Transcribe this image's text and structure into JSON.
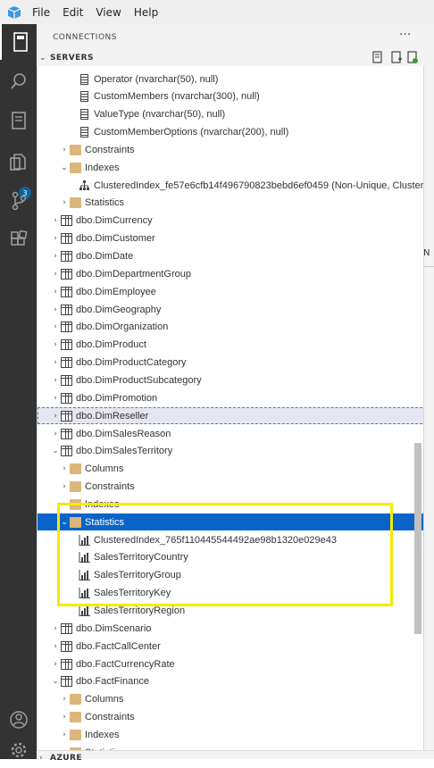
{
  "menu": {
    "items": [
      "File",
      "Edit",
      "View",
      "Help"
    ]
  },
  "sidebar": {
    "title": "CONNECTIONS",
    "more": "···"
  },
  "servers": {
    "label": "SERVERS"
  },
  "azure": {
    "label": "AZURE"
  },
  "activity": {
    "badge": "3"
  },
  "editor": {
    "tab_fragment": "N"
  },
  "tree": [
    {
      "indent": 4,
      "icon": "column-icon",
      "label": "Operator (nvarchar(50), null)"
    },
    {
      "indent": 4,
      "icon": "column-icon",
      "label": "CustomMembers (nvarchar(300), null)"
    },
    {
      "indent": 4,
      "icon": "column-icon",
      "label": "ValueType (nvarchar(50), null)"
    },
    {
      "indent": 4,
      "icon": "column-icon",
      "label": "CustomMemberOptions (nvarchar(200), null)"
    },
    {
      "indent": 3,
      "twisty": "›",
      "icon": "folder-icon",
      "label": "Constraints"
    },
    {
      "indent": 3,
      "twisty": "⌄",
      "icon": "folder-icon",
      "label": "Indexes"
    },
    {
      "indent": 4,
      "icon": "index-icon",
      "label": "ClusteredIndex_fe57e6cfb14f496790823bebd6ef0459 (Non-Unique, Cluster..."
    },
    {
      "indent": 3,
      "twisty": "›",
      "icon": "folder-icon",
      "label": "Statistics"
    },
    {
      "indent": 2,
      "twisty": "›",
      "icon": "table-icon",
      "label": "dbo.DimCurrency"
    },
    {
      "indent": 2,
      "twisty": "›",
      "icon": "table-icon",
      "label": "dbo.DimCustomer"
    },
    {
      "indent": 2,
      "twisty": "›",
      "icon": "table-icon",
      "label": "dbo.DimDate"
    },
    {
      "indent": 2,
      "twisty": "›",
      "icon": "table-icon",
      "label": "dbo.DimDepartmentGroup"
    },
    {
      "indent": 2,
      "twisty": "›",
      "icon": "table-icon",
      "label": "dbo.DimEmployee"
    },
    {
      "indent": 2,
      "twisty": "›",
      "icon": "table-icon",
      "label": "dbo.DimGeography"
    },
    {
      "indent": 2,
      "twisty": "›",
      "icon": "table-icon",
      "label": "dbo.DimOrganization"
    },
    {
      "indent": 2,
      "twisty": "›",
      "icon": "table-icon",
      "label": "dbo.DimProduct"
    },
    {
      "indent": 2,
      "twisty": "›",
      "icon": "table-icon",
      "label": "dbo.DimProductCategory"
    },
    {
      "indent": 2,
      "twisty": "›",
      "icon": "table-icon",
      "label": "dbo.DimProductSubcategory"
    },
    {
      "indent": 2,
      "twisty": "›",
      "icon": "table-icon",
      "label": "dbo.DimPromotion"
    },
    {
      "indent": 2,
      "twisty": "›",
      "icon": "table-icon",
      "label": "dbo.DimReseller",
      "state": "hover"
    },
    {
      "indent": 2,
      "twisty": "›",
      "icon": "table-icon",
      "label": "dbo.DimSalesReason"
    },
    {
      "indent": 2,
      "twisty": "⌄",
      "icon": "table-icon",
      "label": "dbo.DimSalesTerritory"
    },
    {
      "indent": 3,
      "twisty": "›",
      "icon": "folder-icon",
      "label": "Columns"
    },
    {
      "indent": 3,
      "twisty": "›",
      "icon": "folder-icon",
      "label": "Constraints"
    },
    {
      "indent": 3,
      "twisty": "›",
      "icon": "folder-icon",
      "label": "Indexes"
    },
    {
      "indent": 3,
      "twisty": "⌄",
      "icon": "folder-icon",
      "label": "Statistics",
      "state": "selected"
    },
    {
      "indent": 4,
      "icon": "statistics-icon",
      "label": "ClusteredIndex_765f110445544492ae98b1320e029e43"
    },
    {
      "indent": 4,
      "icon": "statistics-icon",
      "label": "SalesTerritoryCountry"
    },
    {
      "indent": 4,
      "icon": "statistics-icon",
      "label": "SalesTerritoryGroup"
    },
    {
      "indent": 4,
      "icon": "statistics-icon",
      "label": "SalesTerritoryKey"
    },
    {
      "indent": 4,
      "icon": "statistics-icon",
      "label": "SalesTerritoryRegion"
    },
    {
      "indent": 2,
      "twisty": "›",
      "icon": "table-icon",
      "label": "dbo.DimScenario"
    },
    {
      "indent": 2,
      "twisty": "›",
      "icon": "table-icon",
      "label": "dbo.FactCallCenter"
    },
    {
      "indent": 2,
      "twisty": "›",
      "icon": "table-icon",
      "label": "dbo.FactCurrencyRate"
    },
    {
      "indent": 2,
      "twisty": "⌄",
      "icon": "table-icon",
      "label": "dbo.FactFinance"
    },
    {
      "indent": 3,
      "twisty": "›",
      "icon": "folder-icon",
      "label": "Columns"
    },
    {
      "indent": 3,
      "twisty": "›",
      "icon": "folder-icon",
      "label": "Constraints"
    },
    {
      "indent": 3,
      "twisty": "›",
      "icon": "folder-icon",
      "label": "Indexes"
    },
    {
      "indent": 3,
      "twisty": "⌄",
      "icon": "folder-icon",
      "label": "Statistics"
    }
  ]
}
